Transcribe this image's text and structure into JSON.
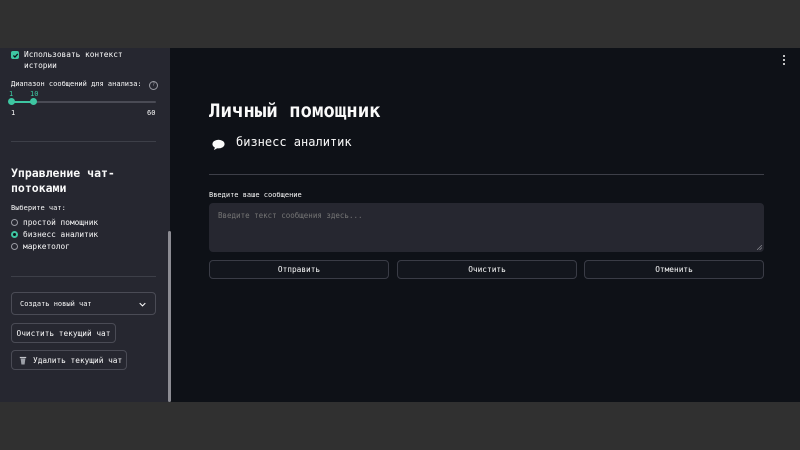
{
  "colors": {
    "accent": "#3ec6a2",
    "sidebar_bg": "#262730",
    "main_bg": "#0e1117"
  },
  "sidebar": {
    "use_context_label": "Использовать контекст истории",
    "use_context_checked": true,
    "slider": {
      "label": "Диапазон сообщений для анализа:",
      "value_low": "1",
      "value_high": "10",
      "min_label": "1",
      "max_label": "60"
    },
    "section_title": "Управление чат-потоками",
    "choose_label": "Выберите чат:",
    "chats": [
      {
        "label": "простой помощник",
        "selected": false
      },
      {
        "label": "бизнесс аналитик",
        "selected": true
      },
      {
        "label": "маркетолог",
        "selected": false
      }
    ],
    "create_select": "Создать новый чат",
    "clear_button": "Очистить текущий чат",
    "delete_button": "Удалить текущий чат",
    "delete_icon": "trash-icon"
  },
  "main": {
    "title": "Личный помощник",
    "subtitle": "бизнесс аналитик",
    "subtitle_icon": "speech-bubble-icon",
    "input_label": "Введите ваше сообщение",
    "input_placeholder": "Введите текст сообщения здесь...",
    "buttons": {
      "send": "Отправить",
      "clear": "Очистить",
      "cancel": "Отменить"
    }
  }
}
